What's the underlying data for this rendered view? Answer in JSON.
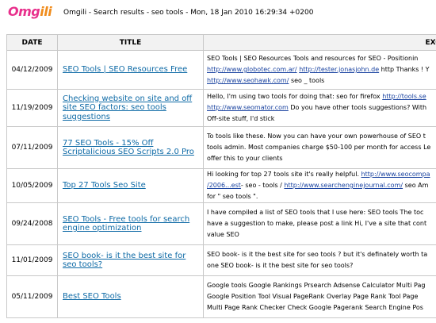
{
  "header": {
    "logo_main": "Omg",
    "logo_accent": "ili",
    "title": "Omgili - Search results - seo tools - Mon, 18 Jan 2010 16:29:34 +0200"
  },
  "columns": {
    "date": "DATE",
    "title": "TITLE",
    "excerpt": "EXCE"
  },
  "rows": [
    {
      "date": "04/12/2009",
      "title": "SEO Tools | SEO Resources Free",
      "lines": [
        [
          {
            "t": "SEO Tools | SEO Resources Tools and resources for SEO - Positionin"
          }
        ],
        [
          {
            "t": "http://www.globotec.com.ar/",
            "link": true
          },
          {
            "t": " "
          },
          {
            "t": "http://tester.jonasjohn.de",
            "link": true
          },
          {
            "t": " http Thanks ! Y"
          }
        ],
        [
          {
            "t": "http://www.seohawk.com/",
            "link": true
          },
          {
            "t": " seo _ tools"
          }
        ]
      ]
    },
    {
      "date": "11/19/2009",
      "title": "Checking website on site and off site SEO factors: seo tools suggestions",
      "lines": [
        [
          {
            "t": "Hello, I'm using two tools for doing that: seo for firefox "
          },
          {
            "t": "http://tools.se",
            "link": true
          }
        ],
        [
          {
            "t": "http://www.seomator.com",
            "link": true
          },
          {
            "t": " Do you have other tools suggestions? With"
          }
        ],
        [
          {
            "t": "Off-site stuff, I'd stick"
          }
        ]
      ]
    },
    {
      "date": "07/11/2009",
      "title": "77 SEO Tools - 15% Off Scriptalicious SEO Scripts 2.0 Pro",
      "lines": [
        [
          {
            "t": "To tools like these. Now you can have your own powerhouse of SEO t"
          }
        ],
        [
          {
            "t": "tools admin. Most companies charge $50-100 per month for access Le"
          }
        ],
        [
          {
            "t": "offer this to your clients"
          }
        ]
      ]
    },
    {
      "date": "10/05/2009",
      "title": "Top 27 Tools Seo Site",
      "lines": [
        [
          {
            "t": "Hi looking for top 27 tools site it's really helpful. "
          },
          {
            "t": "http://www.seocompa",
            "link": true
          }
        ],
        [
          {
            "t": "/2006...est",
            "link": true
          },
          {
            "t": "- seo - tools / "
          },
          {
            "t": "http://www.searchenginejournal.com/",
            "link": true
          },
          {
            "t": " seo Am"
          }
        ],
        [
          {
            "t": "for \" seo tools \"."
          }
        ]
      ]
    },
    {
      "date": "09/24/2008",
      "title": "SEO Tools - Free tools for search engine optimization",
      "lines": [
        [
          {
            "t": "I have compiled a list of SEO tools that I use here: SEO tools The toc"
          }
        ],
        [
          {
            "t": "have a suggestion to make, please post a link Hi, I've a site that cont"
          }
        ],
        [
          {
            "t": "value SEO"
          }
        ]
      ]
    },
    {
      "date": "11/01/2009",
      "title": "SEO book- is it the best site for seo tools?",
      "lines": [
        [
          {
            "t": "SEO book- is it the best site for seo tools ? but it's definately worth ta"
          }
        ],
        [
          {
            "t": "one SEO book- is it the best site for seo tools?"
          }
        ]
      ]
    },
    {
      "date": "05/11/2009",
      "title": "Best SEO Tools",
      "lines": [
        [
          {
            "t": "Google tools Google Rankings Prsearch Adsense Calculator Multi Pag"
          }
        ],
        [
          {
            "t": "Google Position Tool Visual PageRank Overlay Page Rank Tool Page"
          }
        ],
        [
          {
            "t": "Multi Page Rank Checker Check Google Pagerank Search Engine Pos"
          }
        ]
      ]
    }
  ]
}
